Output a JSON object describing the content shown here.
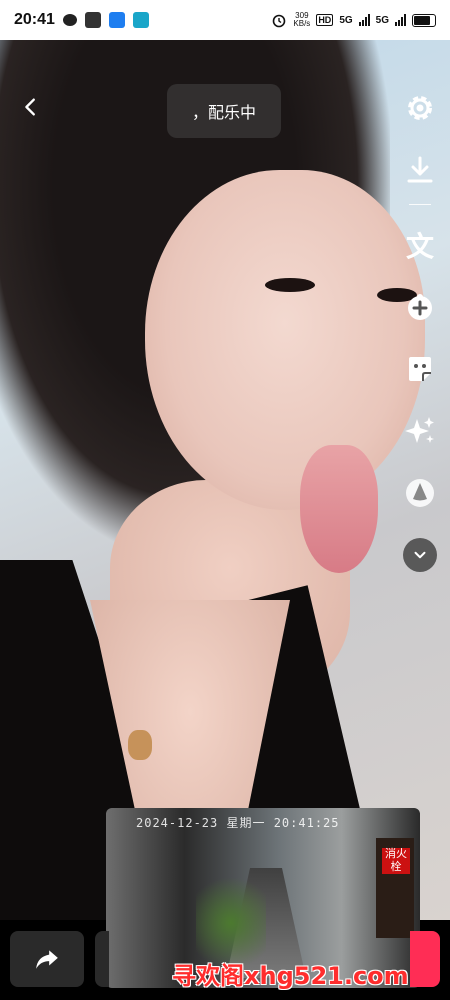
{
  "status_bar": {
    "time": "20:41",
    "network_speed": "309\nKB/s",
    "hd_label": "HD",
    "sim1_label": "5G",
    "sim2_label": "5G",
    "icons": [
      "wechat-icon",
      "map-icon",
      "app-icon-blue",
      "app-icon-teal",
      "alarm-icon",
      "battery-icon"
    ]
  },
  "header": {
    "music_status": "，配乐中",
    "back_icon": "chevron-left-icon"
  },
  "right_rail": {
    "items": [
      {
        "name": "settings",
        "icon": "gear-icon"
      },
      {
        "name": "download",
        "icon": "download-icon"
      },
      {
        "name": "text",
        "icon": "text-icon",
        "label": "文"
      },
      {
        "name": "sticker",
        "icon": "sticker-add-icon"
      },
      {
        "name": "effects",
        "icon": "sticker-face-icon"
      },
      {
        "name": "enhance",
        "icon": "sparkle-icon"
      },
      {
        "name": "filter",
        "icon": "filter-drop-icon"
      },
      {
        "name": "more",
        "icon": "chevron-down-icon"
      }
    ]
  },
  "video": {
    "cctv_timestamp": "2024-12-23 星期一 20:41:25",
    "cctv_sign": "消火栓"
  },
  "bottom_bar": {
    "share_icon": "share-arrow-icon"
  },
  "watermark": "寻欢阁xhg521.com",
  "colors": {
    "accent": "#ff2d55",
    "watermark": "#ff2d2d"
  }
}
